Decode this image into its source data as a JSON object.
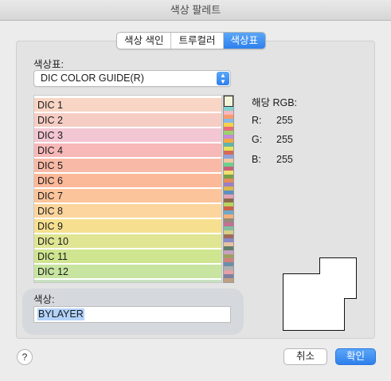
{
  "window": {
    "title": "색상 팔레트"
  },
  "tabs": [
    {
      "label": "색상 색인",
      "active": false
    },
    {
      "label": "트루컬러",
      "active": false
    },
    {
      "label": "색상표",
      "active": true
    }
  ],
  "colorbook": {
    "label": "색상표:",
    "selected": "DIC COLOR GUIDE(R)",
    "items": [
      {
        "label": "DIC 1",
        "color": "#f8d5c4"
      },
      {
        "label": "DIC 2",
        "color": "#f6cdc4"
      },
      {
        "label": "DIC 3",
        "color": "#f2c6d2"
      },
      {
        "label": "DIC 4",
        "color": "#f7b8b8"
      },
      {
        "label": "DIC 5",
        "color": "#f8baa6"
      },
      {
        "label": "DIC 6",
        "color": "#fbb999"
      },
      {
        "label": "DIC 7",
        "color": "#fbc49a"
      },
      {
        "label": "DIC 8",
        "color": "#fbd59d"
      },
      {
        "label": "DIC 9",
        "color": "#f6e08f"
      },
      {
        "label": "DIC 10",
        "color": "#dfe593"
      },
      {
        "label": "DIC 11",
        "color": "#cfe58f"
      },
      {
        "label": "DIC 12",
        "color": "#c7e4a0"
      },
      {
        "label": "",
        "color": "#c7e2c0"
      }
    ],
    "strip_colors": [
      "#f4f4d8",
      "#7fd3d0",
      "#f6b7c0",
      "#f99b6e",
      "#88b8e6",
      "#f5d14a",
      "#e66c7a",
      "#9bd36c",
      "#c58ad8",
      "#f4a742",
      "#5fb3a8",
      "#e3e35c",
      "#d46a5a",
      "#8fa3d9",
      "#f2c8a0",
      "#6fcf8e",
      "#c9607a",
      "#f0e070",
      "#7a9f4a",
      "#e58e5a",
      "#9b7fc6",
      "#d9b84c",
      "#5d8fc0",
      "#e0a3b5",
      "#8c6a4f",
      "#b7d35f",
      "#cf5f4a",
      "#6fa7c9",
      "#f1b07a",
      "#948b7d",
      "#c46f93",
      "#7fbf9f",
      "#d6cf8a",
      "#a06a5a",
      "#8a8ac8",
      "#e6c2a2",
      "#5f7f6a",
      "#c8a0c0",
      "#9f9f60",
      "#d08080",
      "#6a8fa6",
      "#b0b0b0",
      "#e4a0a8",
      "#7f7f9f",
      "#c0a080",
      "#a0c0a0"
    ],
    "color_label": "색상:",
    "color_value": "BYLAYER"
  },
  "rgb": {
    "title": "해당 RGB:",
    "r_label": "R:",
    "r_value": "255",
    "g_label": "G:",
    "g_value": "255",
    "b_label": "B:",
    "b_value": "255"
  },
  "buttons": {
    "help": "?",
    "cancel": "취소",
    "ok": "확인"
  },
  "colors": {
    "accent": "#2f80ed"
  }
}
